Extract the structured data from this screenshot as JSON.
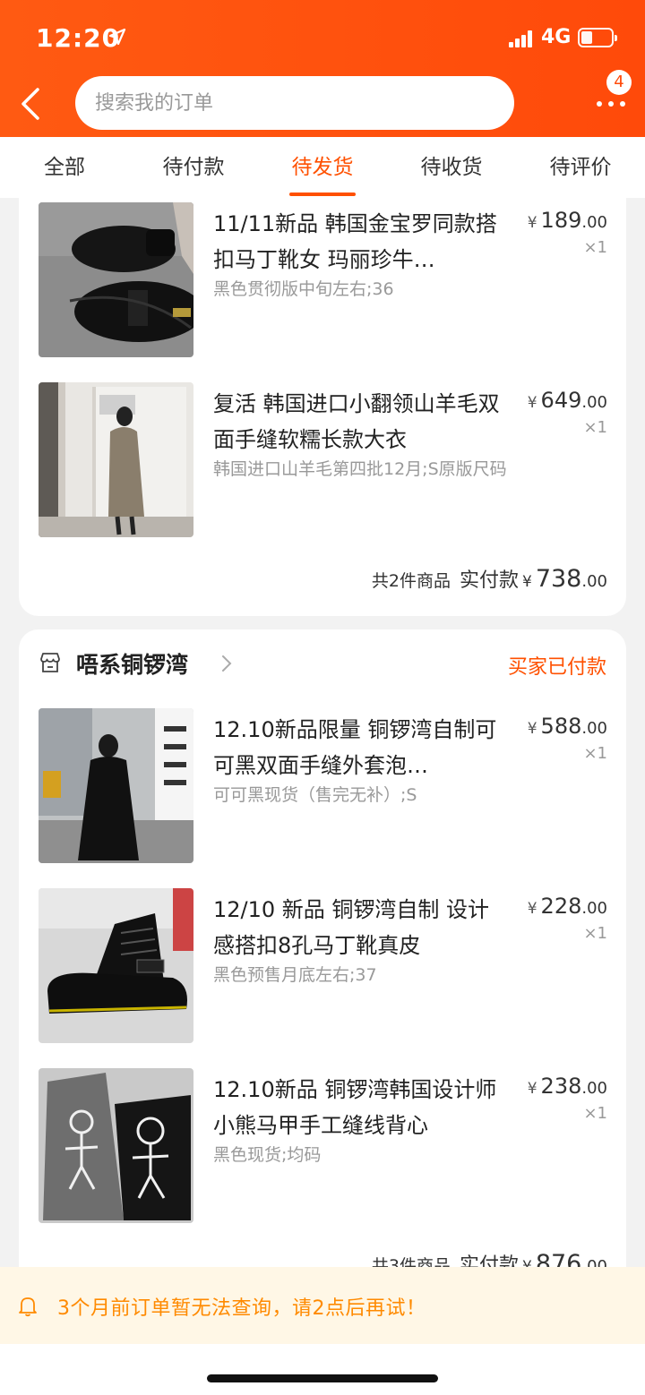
{
  "status_bar": {
    "time": "12:20",
    "network": "4G"
  },
  "search": {
    "placeholder": "搜索我的订单"
  },
  "header": {
    "more_badge": "4"
  },
  "tabs": [
    {
      "label": "全部"
    },
    {
      "label": "待付款"
    },
    {
      "label": "待发货"
    },
    {
      "label": "待收货"
    },
    {
      "label": "待评价"
    }
  ],
  "active_tab_index": 2,
  "orders": [
    {
      "items": [
        {
          "title": "11/11新品 韩国金宝罗同款搭扣马丁靴女 玛丽珍牛…",
          "sku": "黑色贯彻版中旬左右;36",
          "price_symbol": "¥",
          "price_int": "189",
          "price_dec": ".00",
          "qty": "×1"
        },
        {
          "title": "复活 韩国进口小翻领山羊毛双面手缝软糯长款大衣",
          "sku": "韩国进口山羊毛第四批12月;S原版尺码",
          "price_symbol": "¥",
          "price_int": "649",
          "price_dec": ".00",
          "qty": "×1"
        }
      ],
      "summary": {
        "count_text": "共2件商品",
        "label": "实付款",
        "symbol": "¥",
        "int": "738",
        "dec": ".00"
      }
    },
    {
      "shop_name": "唔系铜锣湾",
      "status": "买家已付款",
      "items": [
        {
          "title": "12.10新品限量 铜锣湾自制可可黑双面手缝外套泡…",
          "sku": "可可黑现货（售完无补）;S",
          "price_symbol": "¥",
          "price_int": "588",
          "price_dec": ".00",
          "qty": "×1"
        },
        {
          "title": "12/10 新品 铜锣湾自制 设计感搭扣8孔马丁靴真皮",
          "sku": "黑色预售月底左右;37",
          "price_symbol": "¥",
          "price_int": "228",
          "price_dec": ".00",
          "qty": "×1"
        },
        {
          "title": "12.10新品 铜锣湾韩国设计师小熊马甲手工缝线背心",
          "sku": "黑色现货;均码",
          "price_symbol": "¥",
          "price_int": "238",
          "price_dec": ".00",
          "qty": "×1"
        }
      ],
      "summary": {
        "count_text": "共3件商品",
        "label": "实付款",
        "symbol": "¥",
        "int": "876",
        "dec": ".00"
      }
    }
  ],
  "notice": {
    "text": "3个月前订单暂无法查询，请2点后再试！"
  },
  "colors": {
    "brand": "#ff5000",
    "header": "#ff4a0a",
    "notice_text": "#ff8a00",
    "notice_bg": "#fff7e6"
  }
}
